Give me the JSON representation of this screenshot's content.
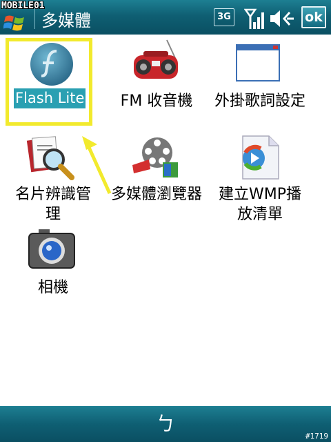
{
  "watermark": "MOBILE01",
  "title": "多媒體",
  "status": {
    "network_label": "3G",
    "ok_label": "ok"
  },
  "apps": [
    {
      "label": "Flash Lite",
      "icon": "flash-lite-icon",
      "selected": true
    },
    {
      "label": "FM 收音機",
      "icon": "radio-icon"
    },
    {
      "label": "外掛歌詞設定",
      "icon": "window-icon"
    },
    {
      "label": "名片辨識管理",
      "icon": "business-card-scanner-icon"
    },
    {
      "label": "多媒體瀏覽器",
      "icon": "film-reel-icon"
    },
    {
      "label": "建立WMP播放清單",
      "icon": "wmp-playlist-icon"
    },
    {
      "label": "相機",
      "icon": "camera-icon"
    }
  ],
  "bottom": {
    "back_glyph": "ㄅ",
    "frame_number": "#1719"
  },
  "colors": {
    "titlebar": "#0f5f73",
    "selection": "#2aa0b2",
    "highlight_box": "#f2ea2d",
    "arrow": "#f2ea2d"
  }
}
